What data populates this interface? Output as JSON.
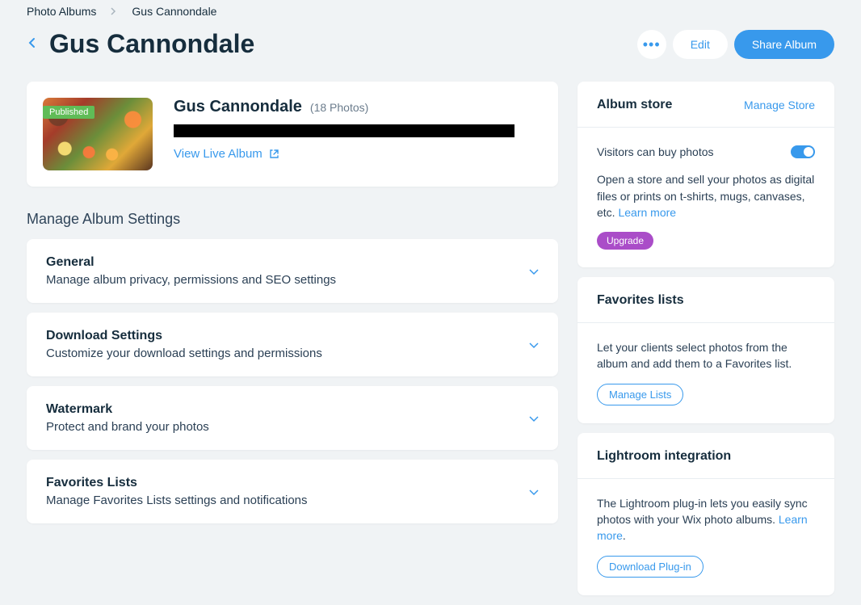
{
  "breadcrumb": {
    "root": "Photo Albums",
    "current": "Gus Cannondale"
  },
  "page_title": "Gus Cannondale",
  "header_actions": {
    "edit": "Edit",
    "share": "Share Album"
  },
  "album": {
    "badge": "Published",
    "name": "Gus Cannondale",
    "count": "(18 Photos)",
    "live_link": "View Live Album"
  },
  "settings_heading": "Manage Album Settings",
  "settings": [
    {
      "title": "General",
      "desc": "Manage album privacy, permissions and SEO settings"
    },
    {
      "title": "Download Settings",
      "desc": "Customize your download settings and permissions"
    },
    {
      "title": "Watermark",
      "desc": "Protect and brand your photos"
    },
    {
      "title": "Favorites Lists",
      "desc": "Manage Favorites Lists settings and notifications"
    }
  ],
  "store": {
    "title": "Album store",
    "manage": "Manage Store",
    "toggle_label": "Visitors can buy photos",
    "desc": "Open a store and sell your photos as digital files or prints on t-shirts, mugs, canvases, etc. ",
    "learn": "Learn more",
    "upgrade": "Upgrade"
  },
  "favorites": {
    "title": "Favorites lists",
    "desc": "Let your clients select photos from the album and add them to a Favorites list.",
    "button": "Manage Lists"
  },
  "lightroom": {
    "title": "Lightroom integration",
    "desc": "The Lightroom plug-in lets you easily sync photos with your Wix photo albums. ",
    "learn": "Learn more",
    "period": ".",
    "button": "Download Plug-in"
  }
}
